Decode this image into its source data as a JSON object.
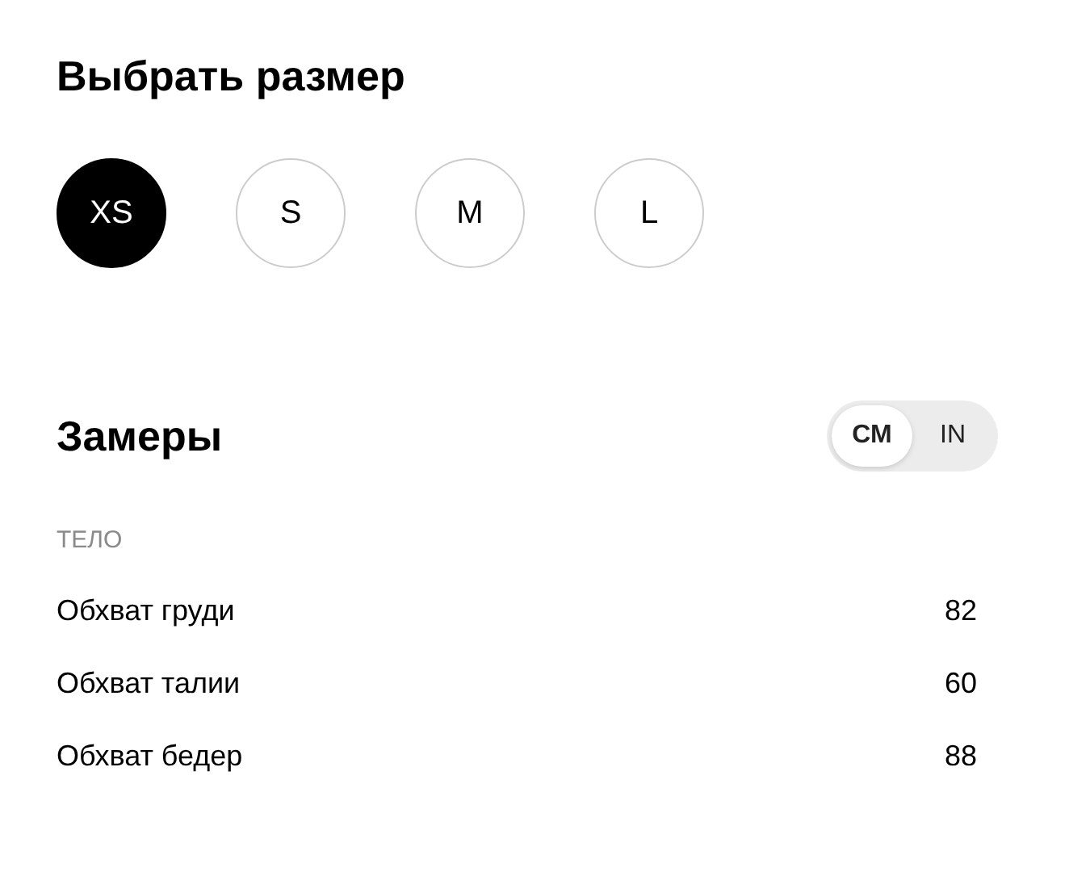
{
  "size_picker": {
    "title": "Выбрать размер",
    "sizes": [
      {
        "label": "XS",
        "selected": true
      },
      {
        "label": "S",
        "selected": false
      },
      {
        "label": "M",
        "selected": false
      },
      {
        "label": "L",
        "selected": false
      }
    ]
  },
  "measurements": {
    "title": "Замеры",
    "units": [
      {
        "label": "СМ",
        "selected": true
      },
      {
        "label": "IN",
        "selected": false
      }
    ],
    "section": "ТЕЛО",
    "rows": [
      {
        "label": "Обхват груди",
        "value": "82"
      },
      {
        "label": "Обхват талии",
        "value": "60"
      },
      {
        "label": "Обхват бедер",
        "value": "88"
      }
    ]
  }
}
